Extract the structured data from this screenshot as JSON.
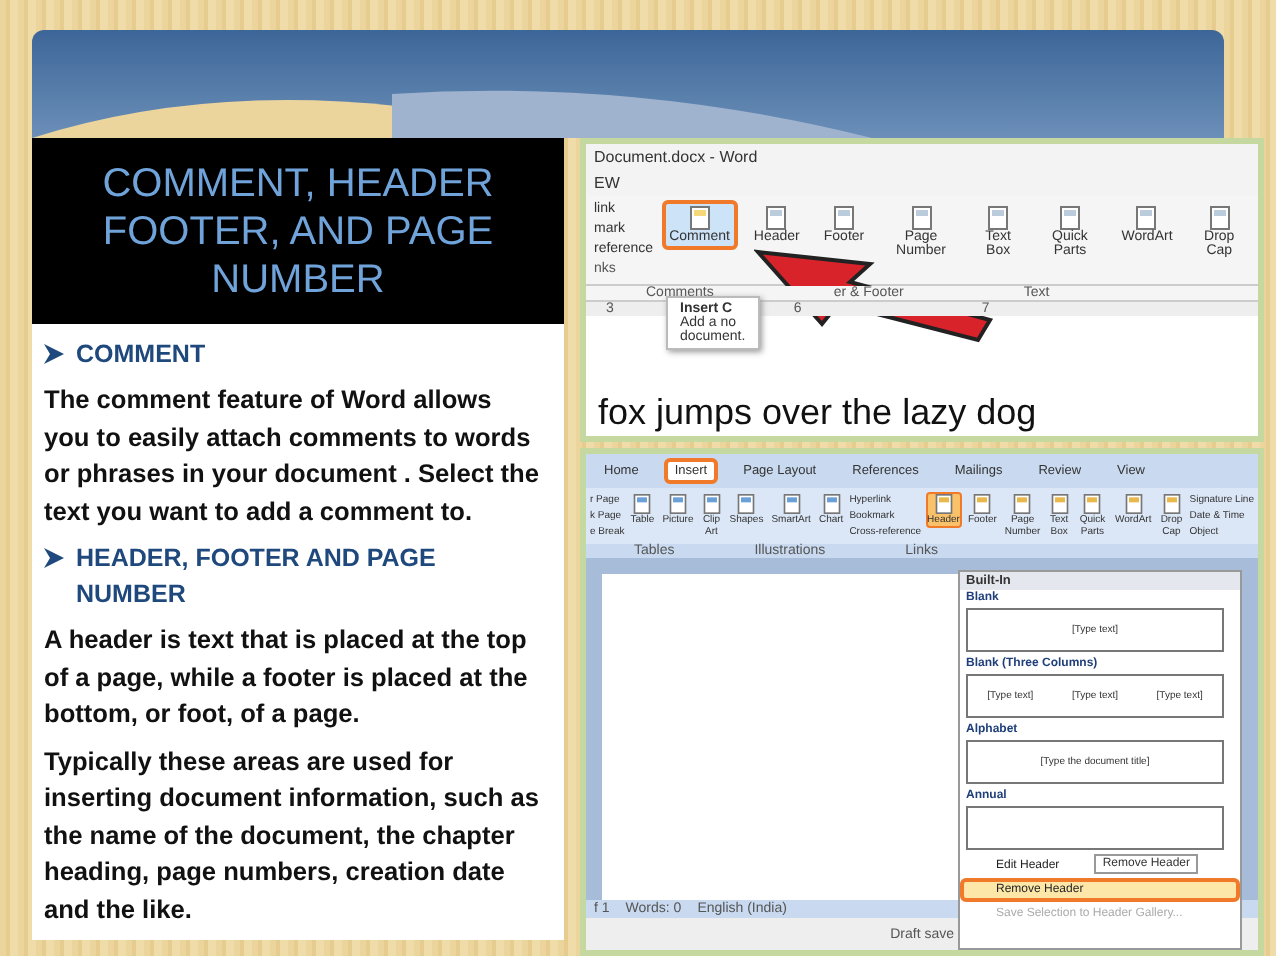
{
  "title": "COMMENT, HEADER FOOTER, AND PAGE NUMBER",
  "sections": [
    {
      "heading": "COMMENT",
      "paragraphs": [
        "The comment feature of Word allows you to easily attach comments to words or phrases in your document . Select the text you want to add a comment to."
      ]
    },
    {
      "heading": "HEADER, FOOTER AND PAGE NUMBER",
      "paragraphs": [
        "A header is text that is placed at the top of a page, while a footer is placed at the bottom, or foot, of a page.",
        "Typically these areas are used for inserting document information, such as the name of the document, the chapter heading, page numbers, creation date and the like."
      ]
    }
  ],
  "screenshot_1": {
    "window_title": "Document.docx - Word",
    "tab": "EW",
    "left_items": [
      "link",
      "mark",
      "reference"
    ],
    "left_group": "nks",
    "buttons": [
      {
        "label": "Comment",
        "selected": true
      },
      {
        "label": "Header",
        "selected": false
      },
      {
        "label": "Footer",
        "selected": false
      },
      {
        "label": "Page Number",
        "selected": false
      },
      {
        "label": "Text Box",
        "selected": false
      },
      {
        "label": "Quick Parts",
        "selected": false
      },
      {
        "label": "WordArt",
        "selected": false
      },
      {
        "label": "Drop Cap",
        "selected": false
      }
    ],
    "groups": [
      "Comments",
      "er & Footer",
      "Text"
    ],
    "ruler": [
      "3",
      "6",
      "7"
    ],
    "tooltip": {
      "title": "Insert C",
      "lines": [
        "Add a no",
        "document."
      ]
    },
    "document_text": "fox jumps over the lazy dog"
  },
  "screenshot_2": {
    "tabs": [
      {
        "label": "Home",
        "selected": false
      },
      {
        "label": "Insert",
        "selected": true
      },
      {
        "label": "Page Layout",
        "selected": false
      },
      {
        "label": "References",
        "selected": false
      },
      {
        "label": "Mailings",
        "selected": false
      },
      {
        "label": "Review",
        "selected": false
      },
      {
        "label": "View",
        "selected": false
      }
    ],
    "left_items": [
      "r Page",
      "k Page",
      "e Break"
    ],
    "buttons": [
      {
        "label": "Table",
        "selected": false
      },
      {
        "label": "Picture",
        "selected": false
      },
      {
        "label": "Clip Art",
        "selected": false
      },
      {
        "label": "Shapes",
        "selected": false
      },
      {
        "label": "SmartArt",
        "selected": false
      },
      {
        "label": "Chart",
        "selected": false
      }
    ],
    "links": [
      "Hyperlink",
      "Bookmark",
      "Cross-reference"
    ],
    "buttons_2": [
      {
        "label": "Header",
        "selected": true
      },
      {
        "label": "Footer",
        "selected": false
      },
      {
        "label": "Page Number",
        "selected": false
      },
      {
        "label": "Text Box",
        "selected": false
      },
      {
        "label": "Quick Parts",
        "selected": false
      },
      {
        "label": "WordArt",
        "selected": false
      },
      {
        "label": "Drop Cap",
        "selected": false
      }
    ],
    "right_items": [
      "Signature Line",
      "Date & Time",
      "Object"
    ],
    "groups": [
      "Tables",
      "Illustrations",
      "Links"
    ],
    "gallery": {
      "heading": "Built-In",
      "items": [
        {
          "name": "Blank",
          "preview": [
            "[Type text]"
          ]
        },
        {
          "name": "Blank (Three Columns)",
          "preview": [
            "[Type text]",
            "[Type text]",
            "[Type text]"
          ]
        },
        {
          "name": "Alphabet",
          "preview": [
            "[Type the document title]"
          ]
        },
        {
          "name": "Annual"
        }
      ]
    },
    "menu": [
      {
        "label": "Edit Header",
        "selected": false,
        "disabled": false
      },
      {
        "label": "Remove Header",
        "selected": true,
        "disabled": false
      },
      {
        "label": "Save Selection to Header Gallery...",
        "selected": false,
        "disabled": true
      }
    ],
    "tooltip": "Remove Header",
    "status": [
      "f 1",
      "Words: 0",
      "English (India)"
    ],
    "draft": "Draft save"
  }
}
